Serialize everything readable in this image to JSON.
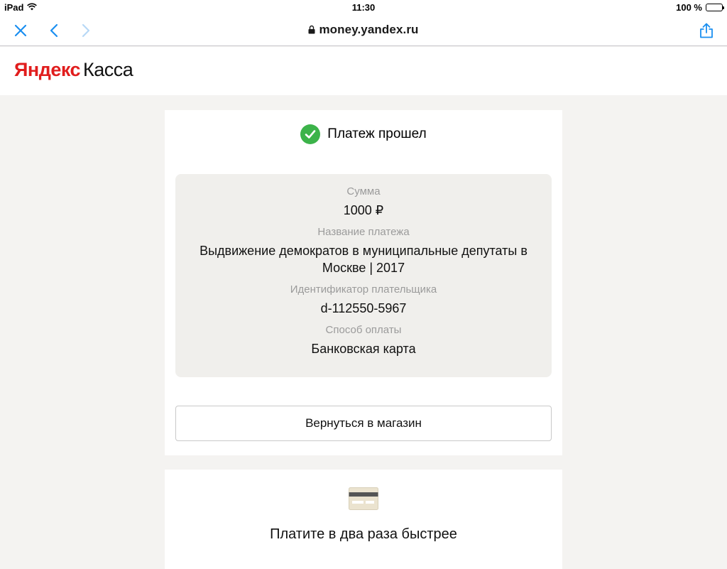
{
  "status_bar": {
    "device": "iPad",
    "time": "11:30",
    "battery_text": "100 %"
  },
  "browser": {
    "url": "money.yandex.ru"
  },
  "site": {
    "logo_brand": "Яндекс",
    "logo_product": "Касса"
  },
  "payment": {
    "status_text": "Платеж прошел",
    "fields": [
      {
        "label": "Сумма",
        "value": "1000 ₽"
      },
      {
        "label": "Название платежа",
        "value": "Выдвижение демократов в муниципальные депутаты в Москве | 2017"
      },
      {
        "label": "Идентификатор плательщика",
        "value": "d-112550-5967"
      },
      {
        "label": "Способ оплаты",
        "value": "Банковская карта"
      }
    ],
    "back_button_label": "Вернуться в магазин"
  },
  "promo": {
    "title": "Платите в два раза быстрее"
  },
  "colors": {
    "ios_blue": "#1a8ff0",
    "success_green": "#3cb34a",
    "yandex_red": "#e11d1d"
  }
}
